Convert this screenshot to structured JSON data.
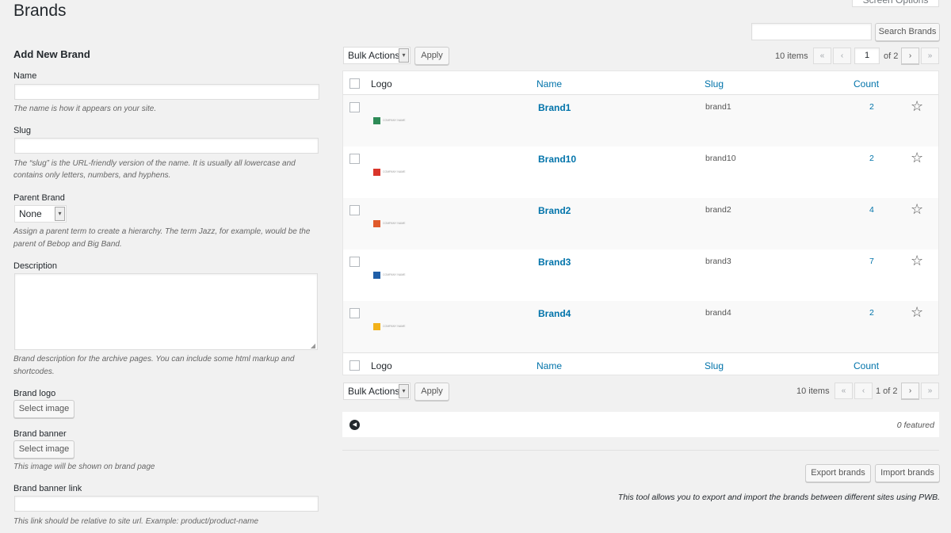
{
  "header": {
    "title": "Brands",
    "screen_options": "Screen Options"
  },
  "search": {
    "button": "Search Brands"
  },
  "form": {
    "title": "Add New Brand",
    "name_label": "Name",
    "name_hint": "The name is how it appears on your site.",
    "slug_label": "Slug",
    "slug_hint_1": "The “slug” is the URL-friendly version of the name. It is usually all lowercase and",
    "slug_hint_2": "contains only letters, numbers, and hyphens.",
    "parent_label": "Parent Brand",
    "parent_value": "None",
    "parent_hint_1": "Assign a parent term to create a hierarchy. The term Jazz, for example, would be the",
    "parent_hint_2": "parent of Bebop and Big Band.",
    "description_label": "Description",
    "description_hint_1": "Brand description for the archive pages. You can include some html markup and",
    "description_hint_2": "shortcodes.",
    "logo_label": "Brand logo",
    "logo_button": "Select image",
    "banner_label": "Brand banner",
    "banner_button": "Select image",
    "banner_hint": "This image will be shown on brand page",
    "banner_link_label": "Brand banner link",
    "banner_link_hint": "This link should be relative to site url. Example: product/product-name"
  },
  "toolbar_top": {
    "bulk_actions": "Bulk Actions",
    "apply": "Apply",
    "items_count": "10 items",
    "first": "«",
    "prev": "‹",
    "page_input": "1",
    "of_pages": "of 2",
    "next": "›",
    "last": "»"
  },
  "toolbar_bottom": {
    "bulk_actions": "Bulk Actions",
    "apply": "Apply",
    "items_count": "10 items",
    "first": "«",
    "prev": "‹",
    "page_text": "1 of 2",
    "next": "›",
    "last": "»"
  },
  "table": {
    "columns": {
      "logo": "Logo",
      "name": "Name",
      "slug": "Slug",
      "count": "Count"
    },
    "rows": [
      {
        "name": "Brand1",
        "slug": "brand1",
        "count": "2",
        "logo_color": "#2e8b57",
        "logo_text": "COMPANY NAME"
      },
      {
        "name": "Brand10",
        "slug": "brand10",
        "count": "2",
        "logo_color": "#d9352b",
        "logo_text": "COMPANY NAME"
      },
      {
        "name": "Brand2",
        "slug": "brand2",
        "count": "4",
        "logo_color": "#e05a2b",
        "logo_text": "COMPANY NAME"
      },
      {
        "name": "Brand3",
        "slug": "brand3",
        "count": "7",
        "logo_color": "#1f5fa8",
        "logo_text": "COMPANY NAME"
      },
      {
        "name": "Brand4",
        "slug": "brand4",
        "count": "2",
        "logo_color": "#f2b21b",
        "logo_text": "COMPANY NAME"
      }
    ]
  },
  "featured": {
    "text": "0 featured"
  },
  "tools": {
    "export": "Export brands",
    "import": "Import brands",
    "note": "This tool allows you to export and import the brands between different sites using PWB."
  }
}
